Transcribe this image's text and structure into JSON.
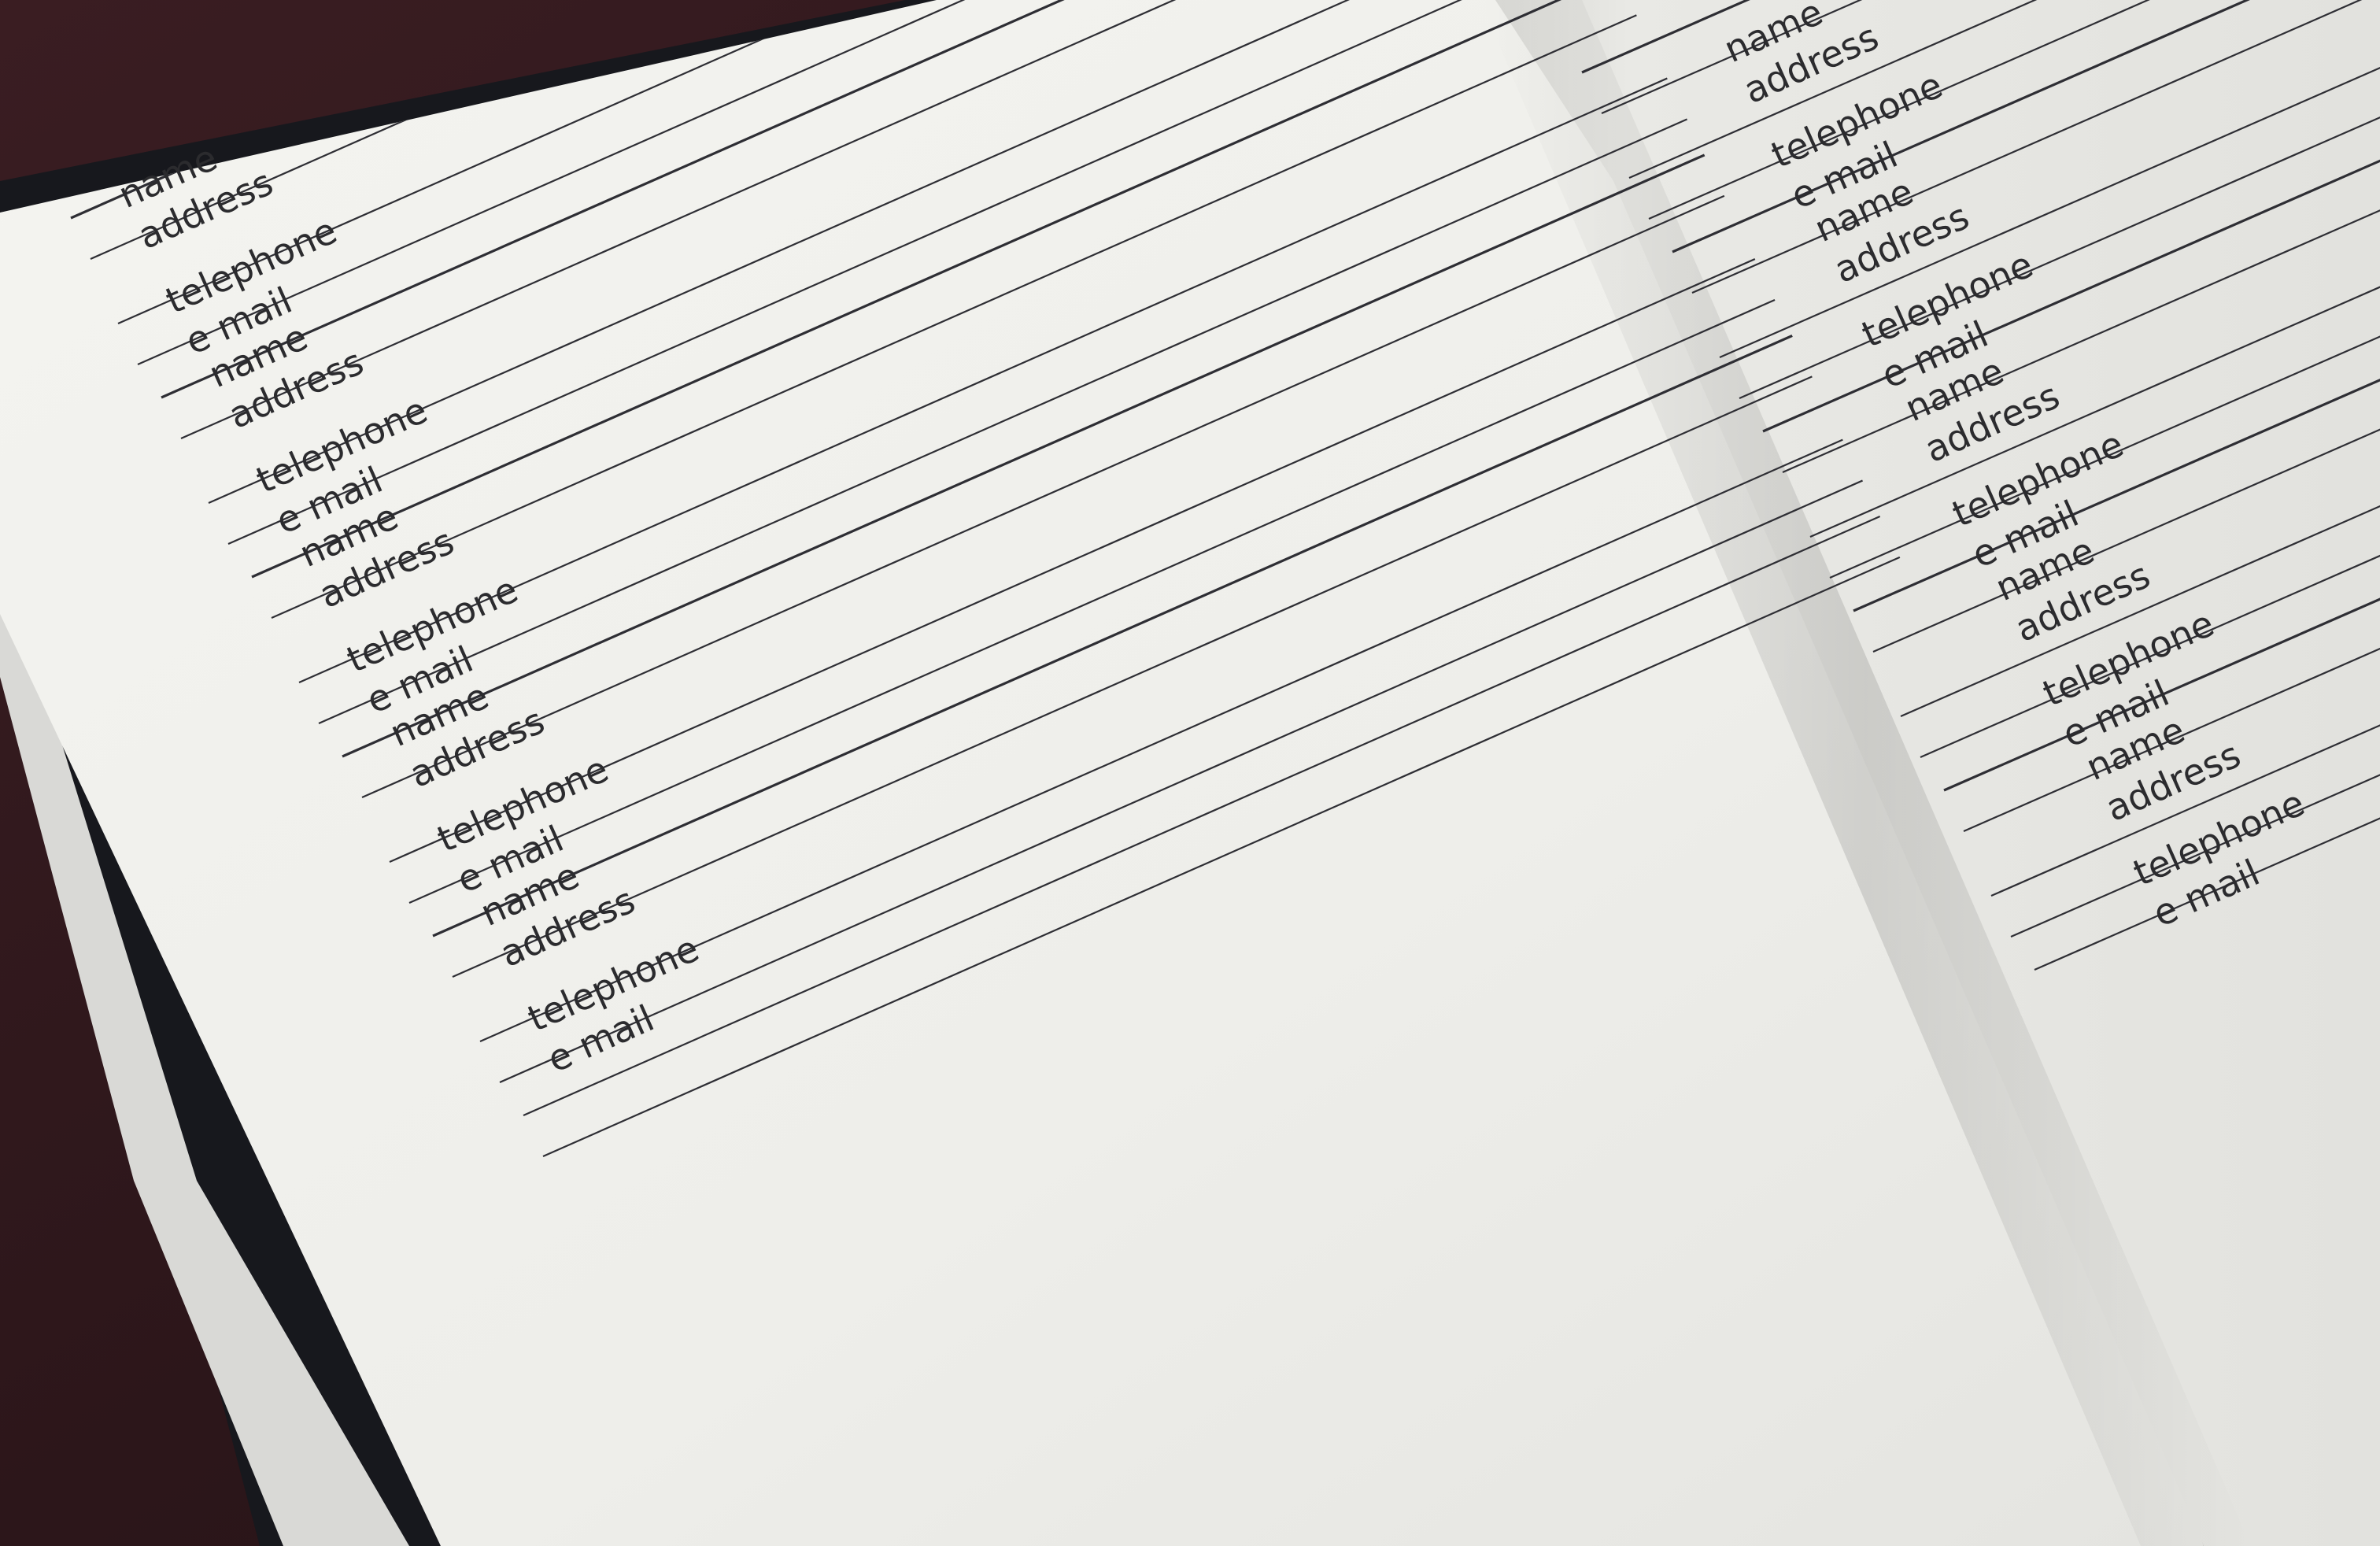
{
  "labels": {
    "name": "name",
    "address": "address",
    "telephone": "telephone",
    "email": "e mail"
  },
  "left_page_entries": 5,
  "right_page_entries": 5,
  "colors": {
    "background_fabric": "#2a1518",
    "cover": "#1a1b20",
    "page_left": "#f1f1ed",
    "page_right": "#e8e8e4",
    "rule": "#2e2e34",
    "text": "#2b2b2e"
  }
}
